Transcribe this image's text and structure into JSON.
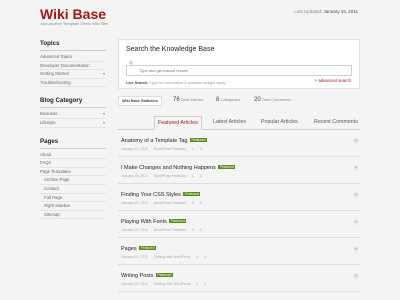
{
  "header": {
    "title": "Wiki Base",
    "tagline": "Just another Template Demo Wiki Site",
    "updated_label": "Last Updated:",
    "updated_date": "January 15, 2011"
  },
  "sidebar": {
    "topics": {
      "heading": "Topics",
      "items": [
        {
          "label": "Advanced Topics",
          "child": false,
          "arrow": false
        },
        {
          "label": "Developer Documentation",
          "child": false,
          "arrow": false
        },
        {
          "label": "Getting Started",
          "child": false,
          "arrow": true
        },
        {
          "label": "Troubleshooting",
          "child": false,
          "arrow": false
        }
      ]
    },
    "blog": {
      "heading": "Blog Category",
      "items": [
        {
          "label": "Business",
          "child": false,
          "arrow": true
        },
        {
          "label": "Lifestyle",
          "child": false,
          "arrow": true
        }
      ]
    },
    "pages": {
      "heading": "Pages",
      "items": [
        {
          "label": "About",
          "child": false,
          "arrow": false
        },
        {
          "label": "FAQs",
          "child": false,
          "arrow": false
        },
        {
          "label": "Page Templates",
          "child": false,
          "arrow": false
        },
        {
          "label": "Archive Page",
          "child": true,
          "arrow": false
        },
        {
          "label": "Contact",
          "child": true,
          "arrow": false
        },
        {
          "label": "Full Page",
          "child": true,
          "arrow": false
        },
        {
          "label": "Right Sidebar",
          "child": true,
          "arrow": false
        },
        {
          "label": "Sitemap",
          "child": true,
          "arrow": false
        }
      ]
    }
  },
  "search": {
    "title": "Search the Knowledge Base",
    "placeholder": "Type and get instant results",
    "hint_label": "Live Search:",
    "hint_text": "Type for information & answers straight away.",
    "advanced_link": "+ advanced search"
  },
  "stats": {
    "label": "Wiki Base Statistics",
    "items": [
      {
        "value": "76",
        "label": "Total Articles"
      },
      {
        "value": "8",
        "label": "Categories"
      },
      {
        "value": "20",
        "label": "Total Comments"
      }
    ]
  },
  "tabs": [
    "Featured Articles",
    "Latest Articles",
    "Popular Articles",
    "Recent Comments"
  ],
  "articles": [
    {
      "title": "Anatomy of a Template Tag",
      "badge": "Featured",
      "date": "January 15, 2011",
      "category": "WordPress Features",
      "comments": "1",
      "views": "3"
    },
    {
      "title": "I Make Changes and Nothing Happens",
      "badge": "Featured",
      "date": "January 15, 2011",
      "category": "WordPress Features",
      "comments": "1",
      "views": "0"
    },
    {
      "title": "Finding Your CSS Styles",
      "badge": "Featured",
      "date": "January 15, 2011",
      "category": "WordPress Features",
      "comments": "0",
      "views": "0"
    },
    {
      "title": "Playing With Fonts",
      "badge": "Featured",
      "date": "January 15, 2011",
      "category": "WordPress Features",
      "comments": "0",
      "views": "0"
    },
    {
      "title": "Pages",
      "badge": "Featured",
      "date": "January 15, 2011",
      "category": "Getting with WordPress",
      "comments": "0",
      "views": "0"
    },
    {
      "title": "Writing Posts",
      "badge": "Featured",
      "date": "January 15, 2011",
      "category": "Getting with WordPress",
      "comments": "0",
      "views": "0"
    }
  ],
  "colors": {
    "accent": "#a0161b",
    "badge": "#5a8a1a"
  },
  "icons": {
    "search": "magnifier-icon",
    "expand": "plus-circle-icon",
    "submenu": "chevron-down-icon"
  }
}
